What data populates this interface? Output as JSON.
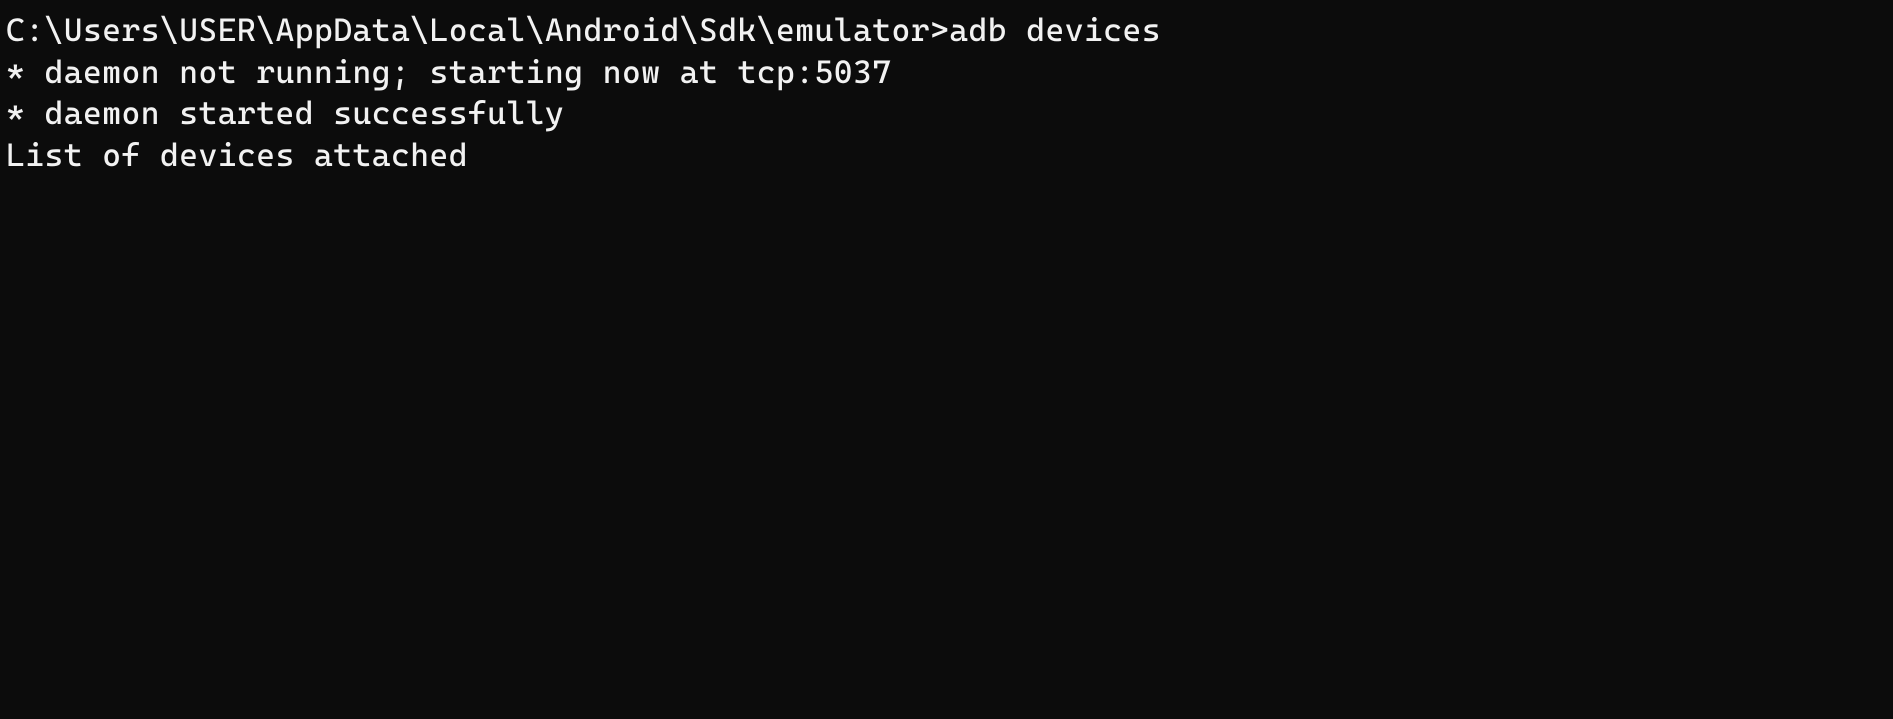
{
  "terminal": {
    "prompt": "C:\\Users\\USER\\AppData\\Local\\Android\\Sdk\\emulator>",
    "command": "adb devices",
    "output": [
      "* daemon not running; starting now at tcp:5037",
      "* daemon started successfully",
      "List of devices attached"
    ]
  }
}
